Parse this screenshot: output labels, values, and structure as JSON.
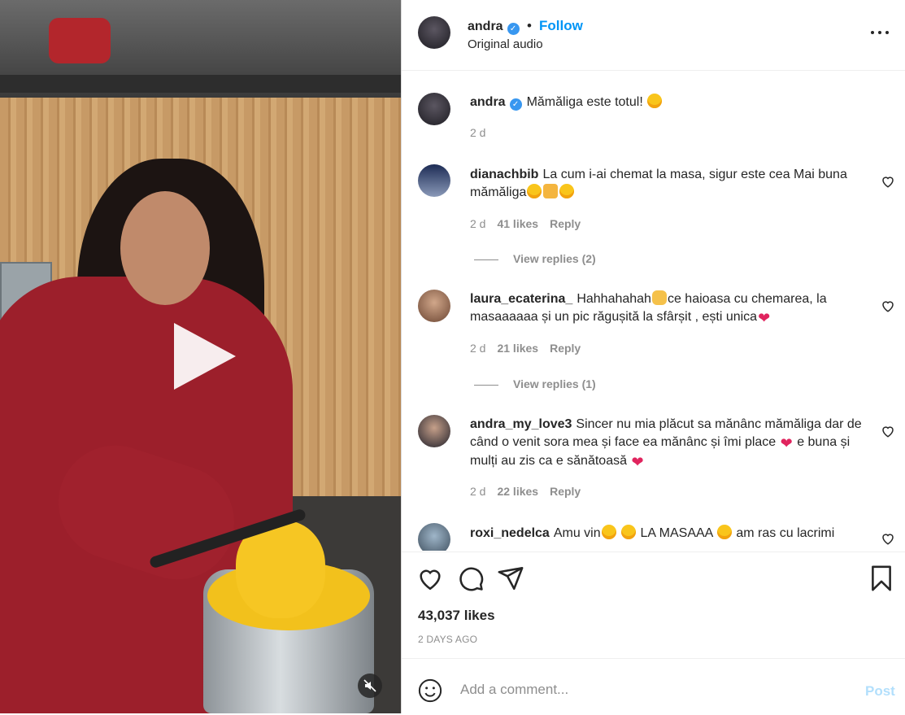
{
  "video": {
    "play_icon": "play-icon",
    "mute_icon": "muted-speaker-icon"
  },
  "header": {
    "username": "andra",
    "verified_icon": "verified-badge-icon",
    "separator": "•",
    "follow_label": "Follow",
    "audio_label": "Original audio",
    "more_icon": "more-options-icon"
  },
  "caption": {
    "username": "andra",
    "text": "Mămăliga este totul!",
    "time": "2 d"
  },
  "comments": [
    {
      "username": "dianachbib",
      "text": "La cum i-ai chemat la masa, sigur este cea Mai buna mămăliga",
      "time": "2 d",
      "likes": "41 likes",
      "reply_label": "Reply",
      "view_replies": "View replies (2)"
    },
    {
      "username": "laura_ecaterina_",
      "text_a": "Hahhahahah",
      "text_b": "ce haioasa cu chemarea, la masaaaaaa și un pic răgușită la sfârșit , ești unica",
      "time": "2 d",
      "likes": "21 likes",
      "reply_label": "Reply",
      "view_replies": "View replies (1)"
    },
    {
      "username": "andra_my_love3",
      "text_a": "Sincer nu mia plăcut sa mănânc mămăliga dar de când o venit sora mea și face ea mănânc și îmi place",
      "text_b": "e buna și mulți au zis ca e sănătoasă",
      "time": "2 d",
      "likes": "22 likes",
      "reply_label": "Reply"
    },
    {
      "username": "roxi_nedelca",
      "text_a": "Amu vin",
      "text_b": "LA MASAAA",
      "text_c": "am ras cu lacrimi"
    }
  ],
  "actions": {
    "like_icon": "heart-icon",
    "comment_icon": "comment-icon",
    "share_icon": "share-icon",
    "save_icon": "bookmark-icon",
    "likes": "43,037 likes",
    "date": "2 DAYS AGO"
  },
  "composer": {
    "emoji_icon": "emoji-icon",
    "placeholder": "Add a comment...",
    "post_label": "Post"
  },
  "colors": {
    "accent": "#0095f6",
    "muted_text": "#8e8e8e",
    "post_disabled": "#b2dffc",
    "heart_red": "#e0245e"
  }
}
